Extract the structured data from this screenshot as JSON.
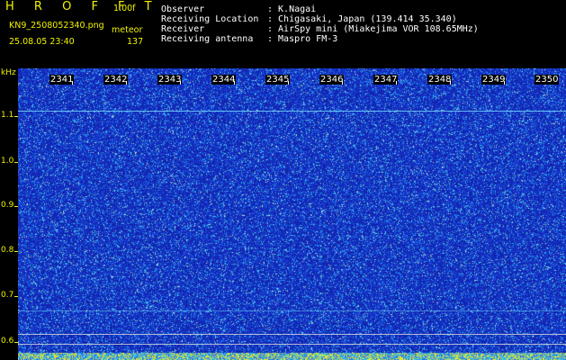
{
  "app": {
    "title": "H R O F F T",
    "version": "1.00f"
  },
  "file": {
    "name": "KN9_2508052340.png",
    "datetime": "25.08.05 23:40"
  },
  "meteor": {
    "label": "meteor",
    "count": "137"
  },
  "station": {
    "rows": [
      {
        "key": "Observer",
        "value": ": K.Nagai"
      },
      {
        "key": "Receiving Location",
        "value": ": Chigasaki, Japan (139.414 35.340)"
      },
      {
        "key": "Receiver",
        "value": ": AirSpy mini (Miakejima VOR 108.65MHz)"
      },
      {
        "key": "Receiving antenna",
        "value": ": Maspro FM-3"
      }
    ]
  },
  "axis": {
    "unit": "kHz",
    "freq_labels": [
      "1.1",
      "1.0",
      "0.9",
      "0.8",
      "0.7",
      "0.6"
    ],
    "time_labels": [
      "2341",
      "2342",
      "2343",
      "2344",
      "2345",
      "2346",
      "2347",
      "2348",
      "2349",
      "2350"
    ]
  },
  "colors": {
    "label_yellow": "#f2f200",
    "background": "#000000",
    "waterfall_base": "#1a2fb8"
  }
}
